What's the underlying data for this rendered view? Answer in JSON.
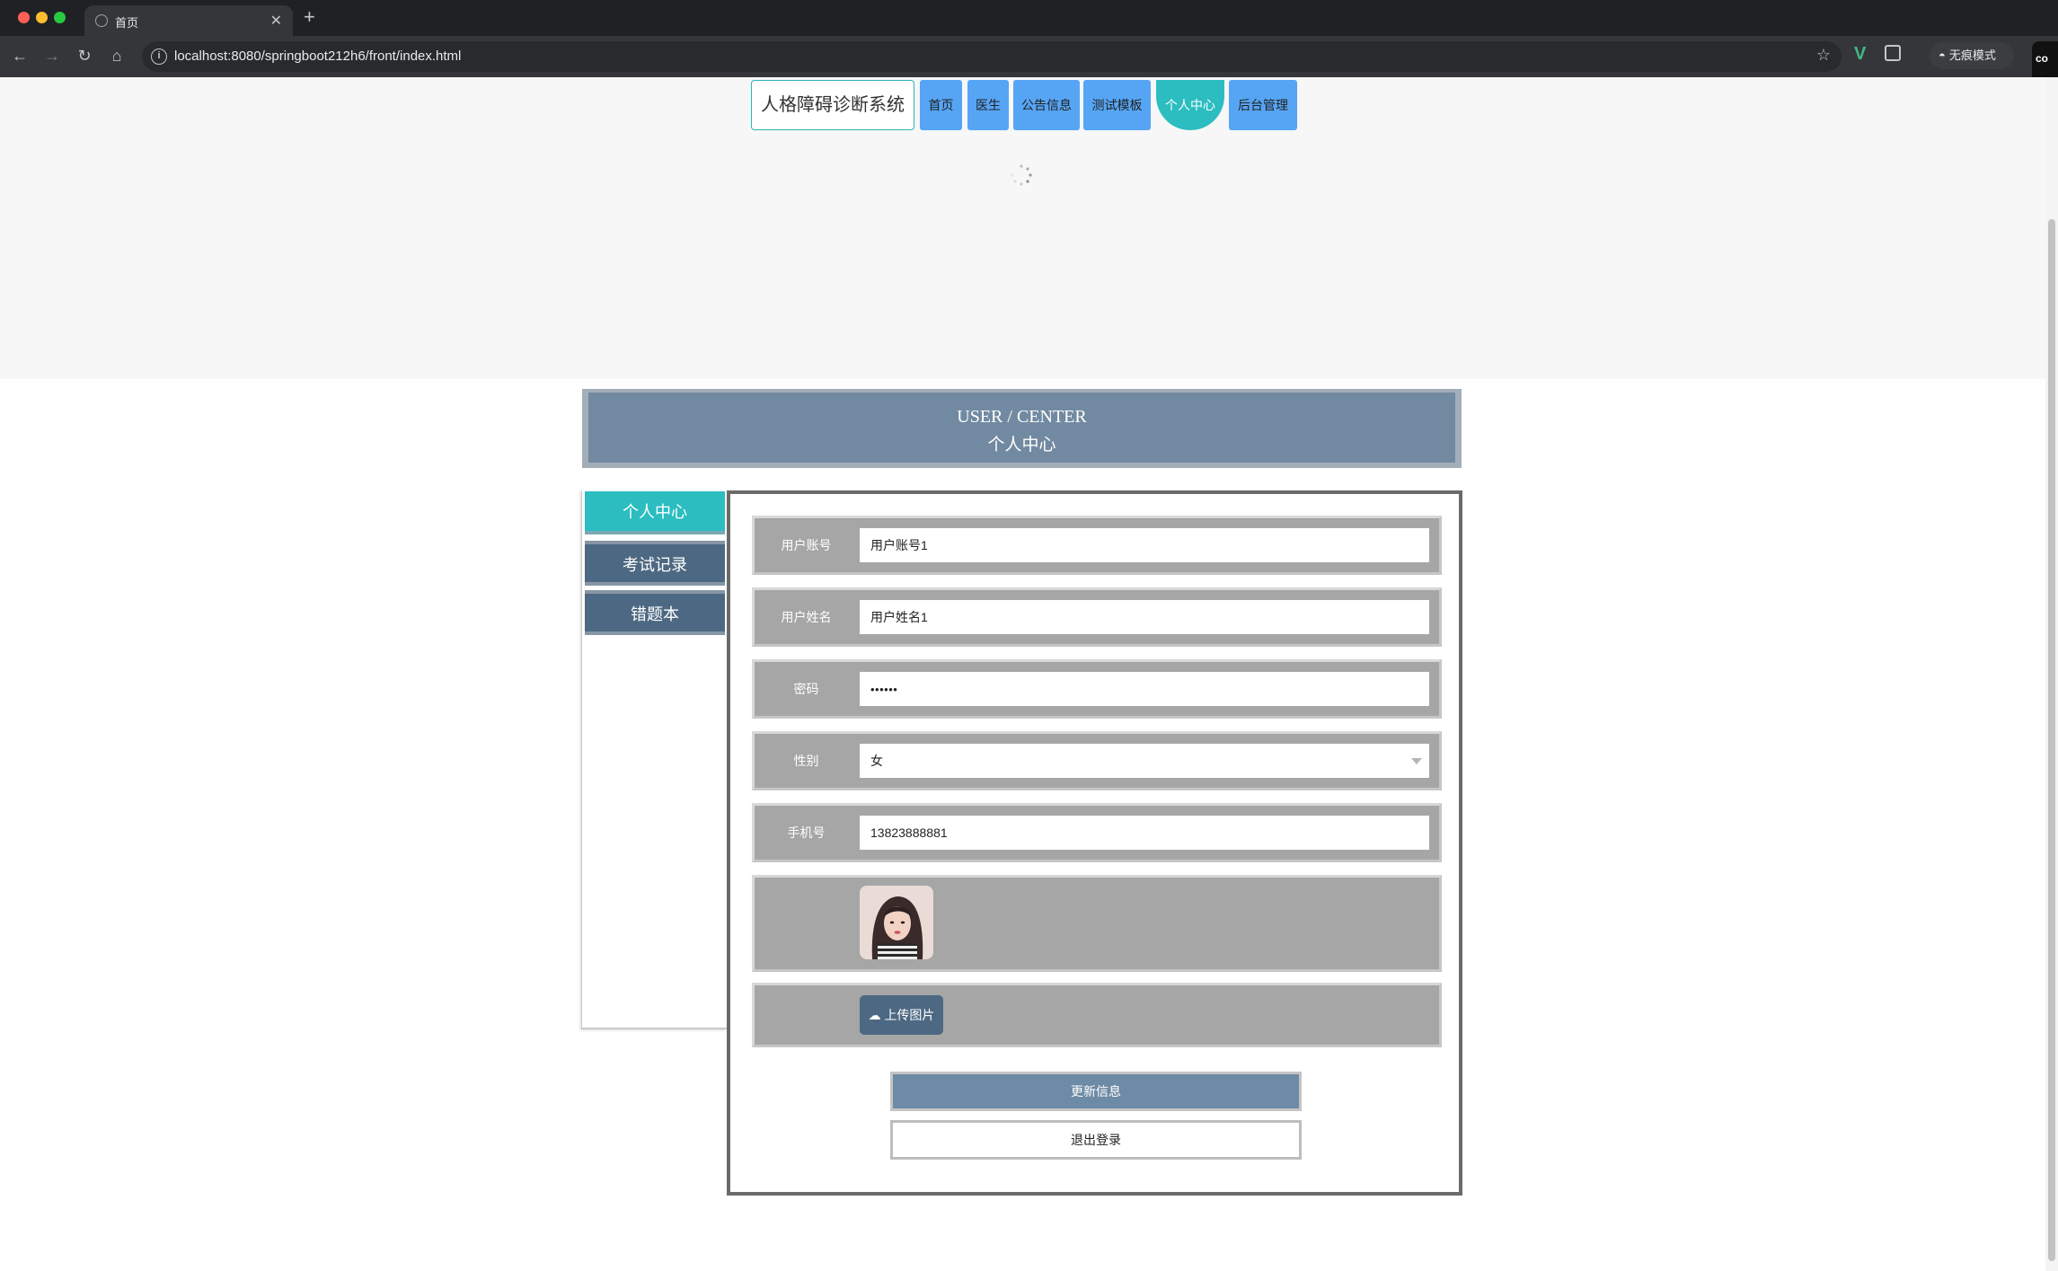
{
  "browser": {
    "tab_title": "首页",
    "url": "localhost:8080/springboot212h6/front/index.html",
    "incognito_label": "无痕模式",
    "side_peek_text": "co"
  },
  "nav": {
    "site_title": "人格障碍诊断系统",
    "items": [
      {
        "label": "首页"
      },
      {
        "label": "医生"
      },
      {
        "label": "公告信息"
      },
      {
        "label": "测试模板"
      },
      {
        "label": "个人中心"
      },
      {
        "label": "后台管理"
      }
    ],
    "active_index": 4
  },
  "header": {
    "en": "USER / CENTER",
    "cn": "个人中心"
  },
  "sidebar": {
    "items": [
      {
        "label": "个人中心"
      },
      {
        "label": "考试记录"
      },
      {
        "label": "错题本"
      }
    ]
  },
  "form": {
    "account": {
      "label": "用户账号",
      "value": "用户账号1"
    },
    "name": {
      "label": "用户姓名",
      "value": "用户姓名1"
    },
    "password": {
      "label": "密码",
      "value": "••••••"
    },
    "gender": {
      "label": "性别",
      "value": "女"
    },
    "phone": {
      "label": "手机号",
      "value": "13823888881"
    },
    "upload_label": "上传图片",
    "update_label": "更新信息",
    "logout_label": "退出登录"
  },
  "colors": {
    "accent": "#2bbdc0",
    "nav_blue": "#56a5f5",
    "slate": "#4d6882",
    "header_plate": "#728aa1"
  }
}
